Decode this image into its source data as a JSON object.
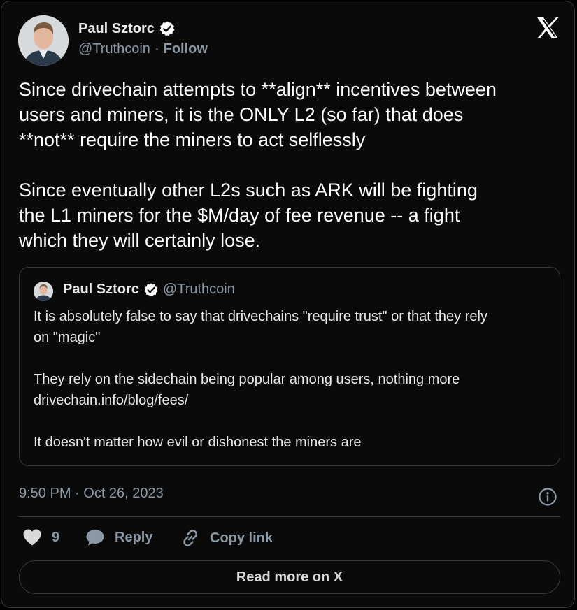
{
  "author": {
    "name": "Paul Sztorc",
    "handle": "@Truthcoin",
    "separator": "·",
    "follow_label": "Follow"
  },
  "tweet": {
    "text": "Since drivechain attempts to **align** incentives between\nusers and miners, it is the ONLY L2 (so far) that does\n**not** require the miners to act selflessly\n\nSince eventually other L2s such as ARK will be fighting\nthe L1 miners for the $M/day of fee revenue -- a fight\nwhich they will certainly lose.",
    "timestamp": "9:50 PM · Oct 26, 2023"
  },
  "quoted_tweet": {
    "name": "Paul Sztorc",
    "handle": "@Truthcoin",
    "text": "It is absolutely false to say that drivechains \"require trust\" or that they rely\non \"magic\"\n\nThey rely on the sidechain being popular among users, nothing more\ndrivechain.info/blog/fees/\n\nIt doesn't matter how evil or dishonest the miners are"
  },
  "actions": {
    "like_count": "9",
    "reply_label": "Reply",
    "copy_link_label": "Copy link"
  },
  "read_more_label": "Read more on X",
  "icons": {
    "verified": "verified-badge-icon",
    "brand": "x-logo-icon",
    "info": "info-icon",
    "like": "heart-icon",
    "reply": "speech-bubble-icon",
    "copy": "link-icon"
  },
  "colors": {
    "background": "#000000",
    "text_primary": "#e7e9ea",
    "text_secondary": "#8b98a5",
    "border": "#3a3a3a"
  }
}
